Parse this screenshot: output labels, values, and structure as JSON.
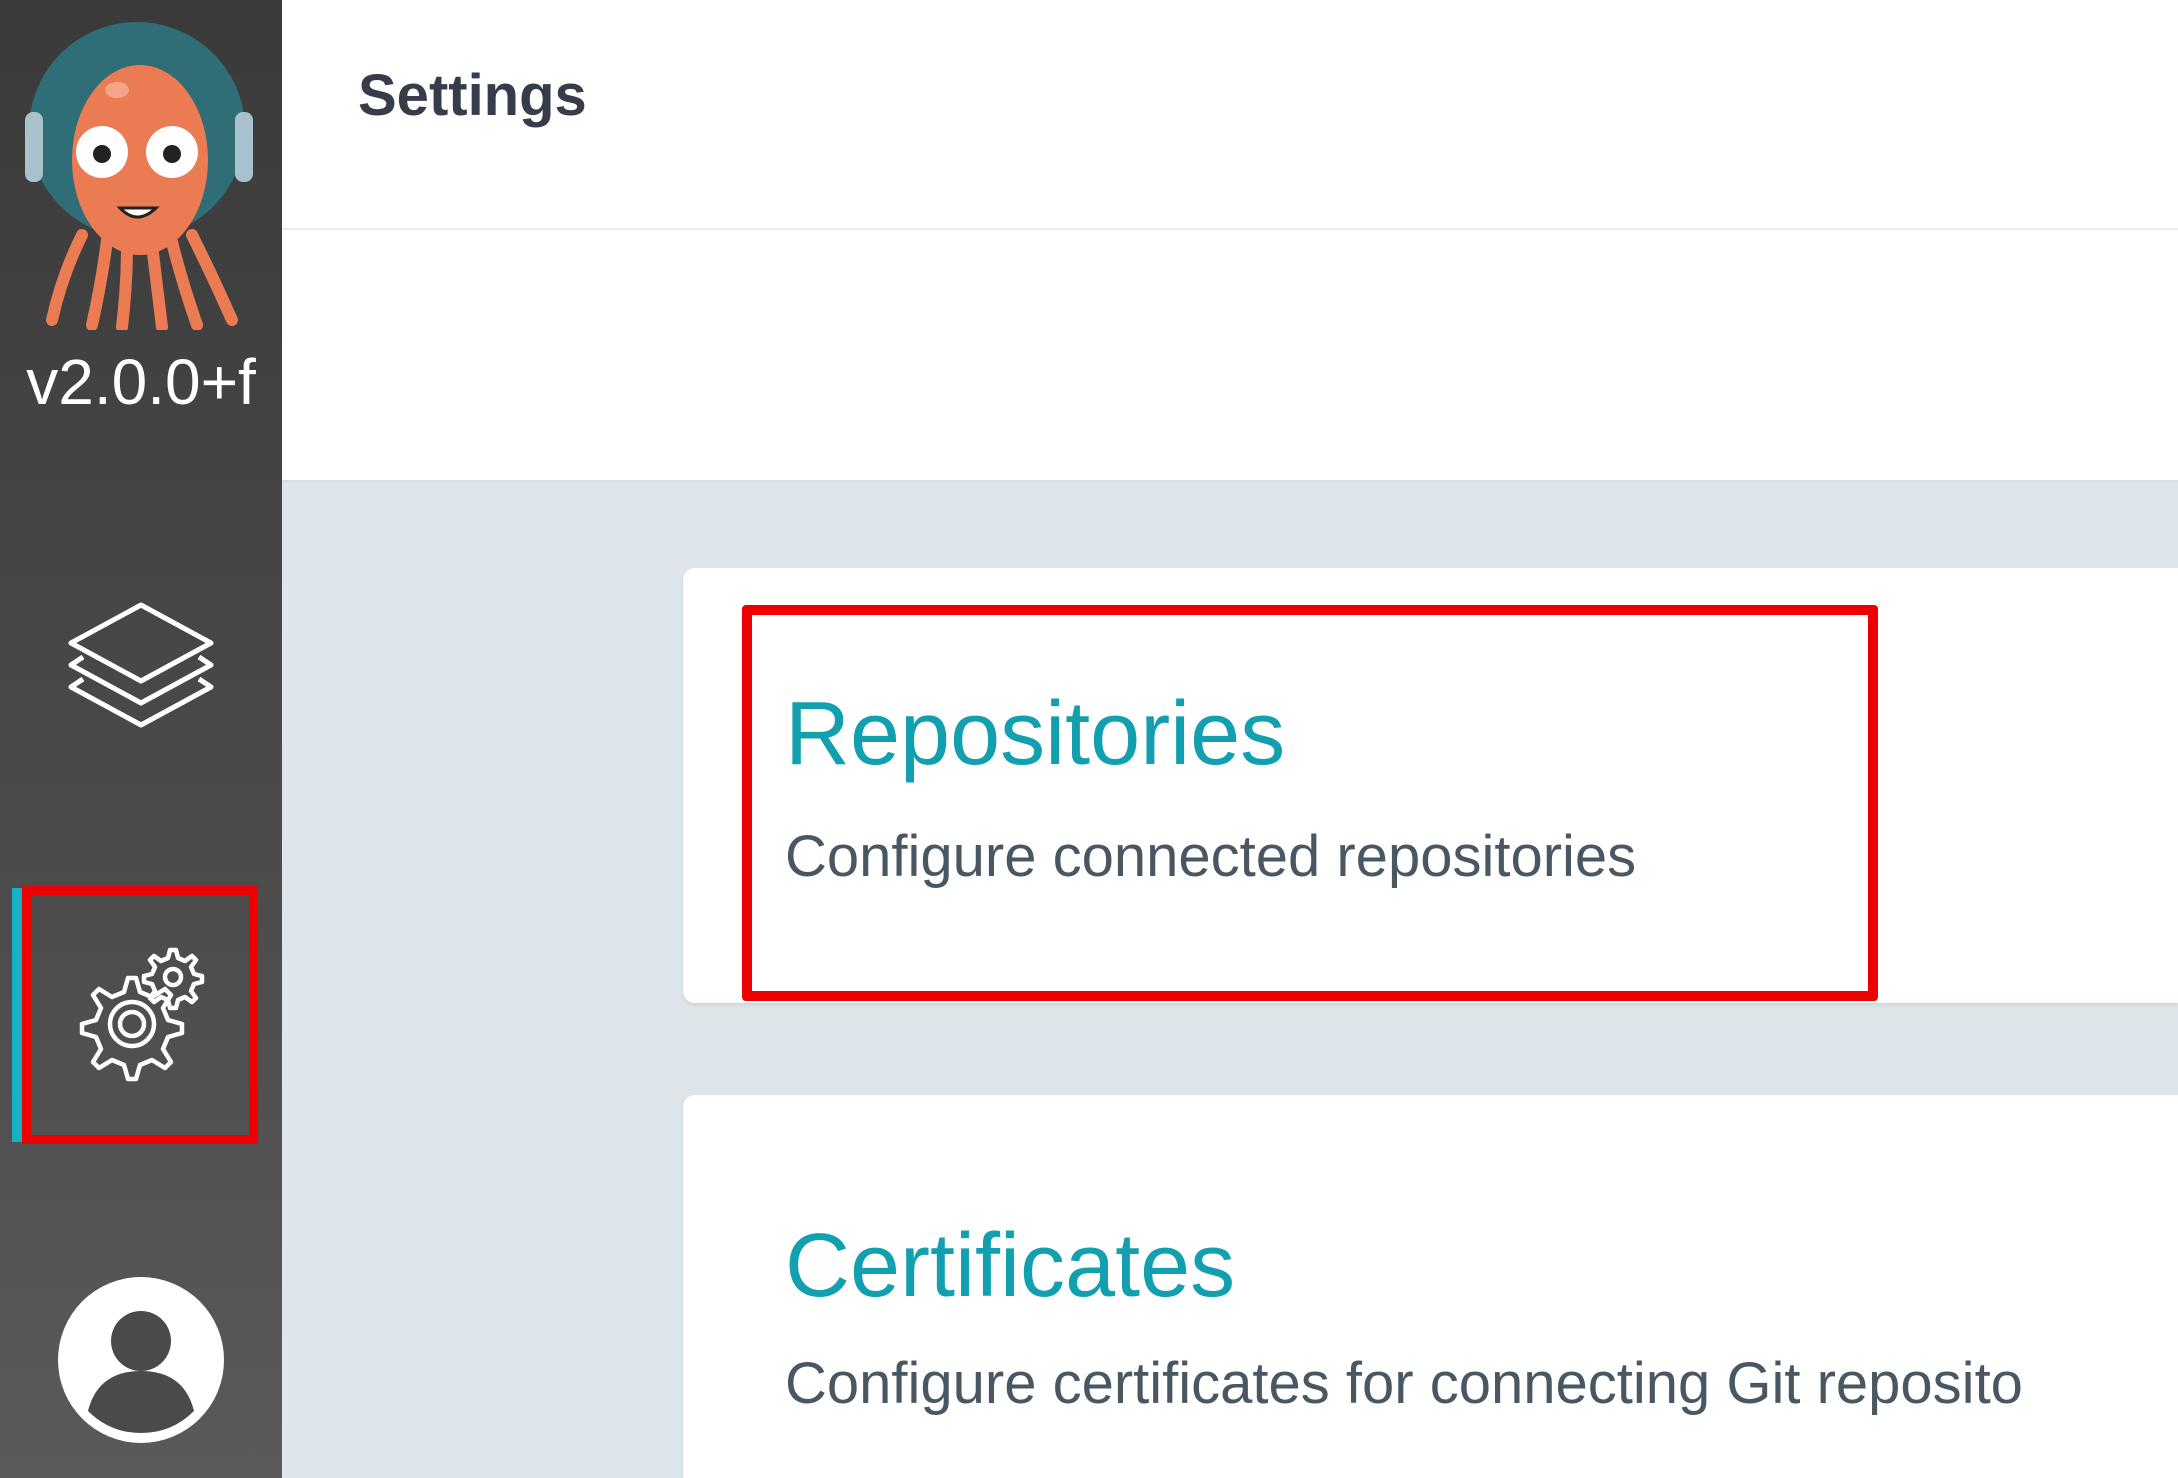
{
  "sidebar": {
    "version": "v2.0.0+f",
    "items": [
      {
        "name": "applications",
        "icon": "layers-icon"
      },
      {
        "name": "settings",
        "icon": "gears-icon",
        "active": true
      },
      {
        "name": "user-info",
        "icon": "user-avatar-icon"
      }
    ],
    "accent_color": "#18b0c2"
  },
  "header": {
    "title": "Settings"
  },
  "cards": [
    {
      "title": "Repositories",
      "description": "Configure connected repositories"
    },
    {
      "title": "Certificates",
      "description": "Configure certificates for connecting Git reposito"
    }
  ],
  "colors": {
    "card_title": "#12a0b0",
    "highlight": "#ee0000",
    "background": "#dee6eb"
  }
}
